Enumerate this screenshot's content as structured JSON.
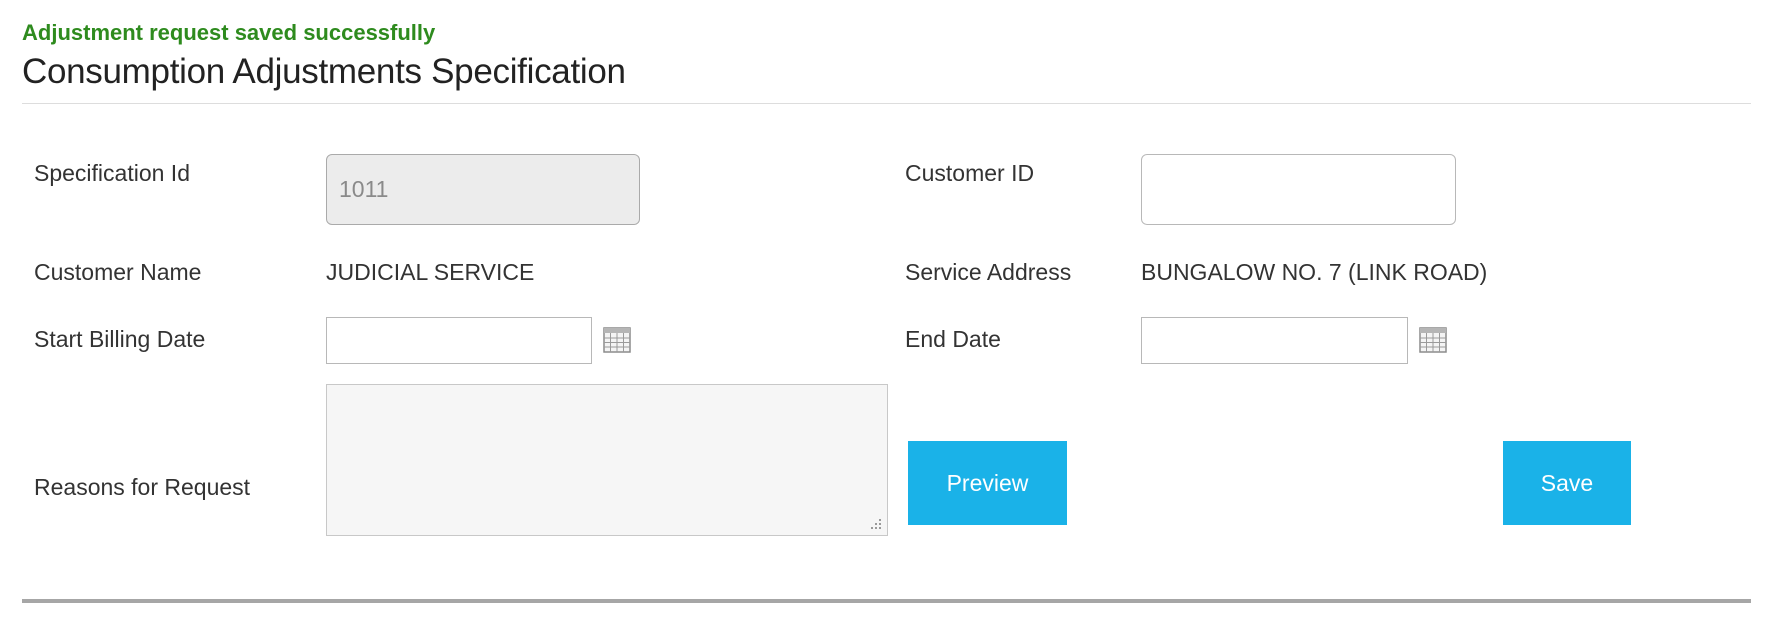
{
  "message": {
    "success": "Adjustment request saved successfully",
    "success_color": "#2e8b1e"
  },
  "header": {
    "title": "Consumption Adjustments Specification"
  },
  "form": {
    "specification_id": {
      "label": "Specification Id",
      "value": "1011",
      "readonly": true
    },
    "customer_id": {
      "label": "Customer ID",
      "value": ""
    },
    "customer_name": {
      "label": "Customer Name",
      "value": "JUDICIAL SERVICE"
    },
    "service_address": {
      "label": "Service Address",
      "value": "BUNGALOW NO. 7 (LINK ROAD)"
    },
    "start_billing_date": {
      "label": "Start Billing Date",
      "value": "",
      "icon": "calendar-icon"
    },
    "end_date": {
      "label": "End Date",
      "value": "",
      "icon": "calendar-icon"
    },
    "reasons": {
      "label": "Reasons for Request",
      "value": ""
    }
  },
  "actions": {
    "preview_label": "Preview",
    "save_label": "Save",
    "button_color": "#1ab2e8"
  }
}
